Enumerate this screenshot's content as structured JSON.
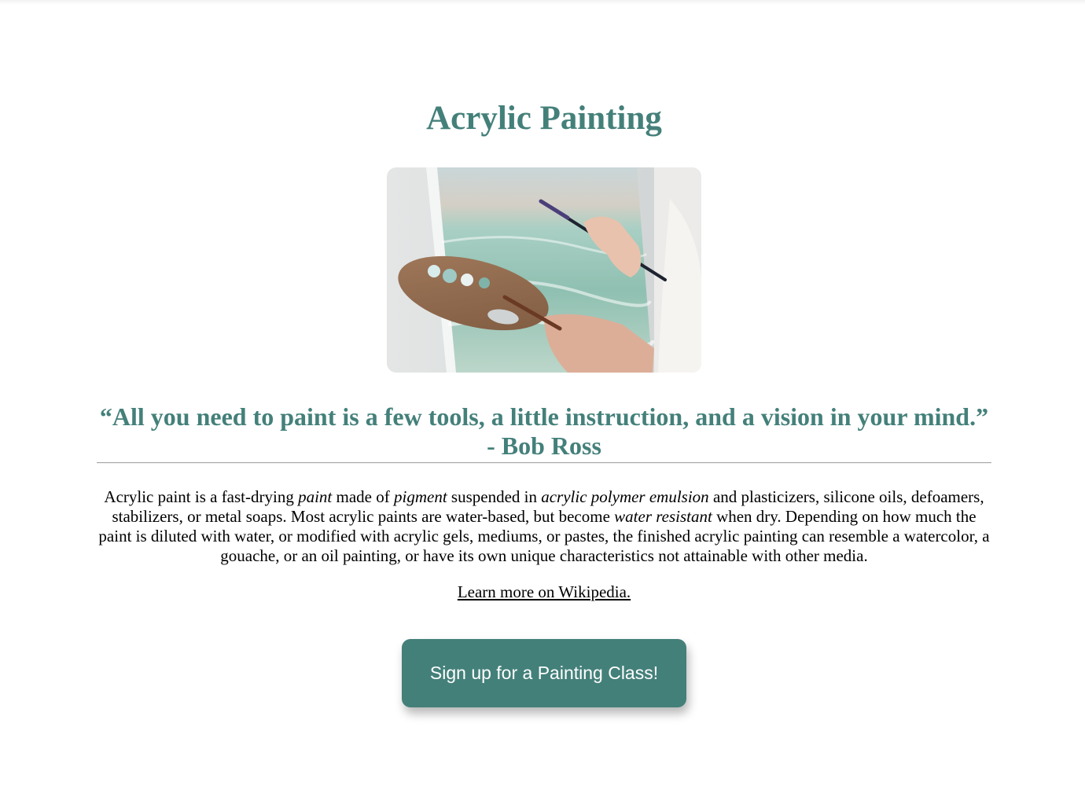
{
  "page": {
    "title": "Acrylic Painting",
    "hero_image_alt": "hero image",
    "quote_line1": "“All you need to paint is a few tools, a little instruction, and a vision in your mind.”",
    "quote_line2": "- Bob Ross",
    "description": {
      "t1": "Acrylic paint is a fast-drying ",
      "em1": "paint",
      "t2": " made of ",
      "em2": "pigment",
      "t3": " suspended in ",
      "em3": "acrylic polymer emulsion",
      "t4": " and plasticizers, silicone oils, defoamers, stabilizers, or metal soaps. Most acrylic paints are water-based, but become ",
      "em4": "water resistant",
      "t5": " when dry. Depending on how much the paint is diluted with water, or modified with acrylic gels, mediums, or pastes, the finished acrylic painting can resemble a watercolor, a gouache, or an oil painting, or have its own unique characteristics not attainable with other media."
    },
    "wiki_link": "Learn more on Wikipedia.",
    "cta_label": "Sign up for a Painting Class!"
  },
  "colors": {
    "accent": "#44807a",
    "text": "#000000",
    "background": "#ffffff"
  }
}
